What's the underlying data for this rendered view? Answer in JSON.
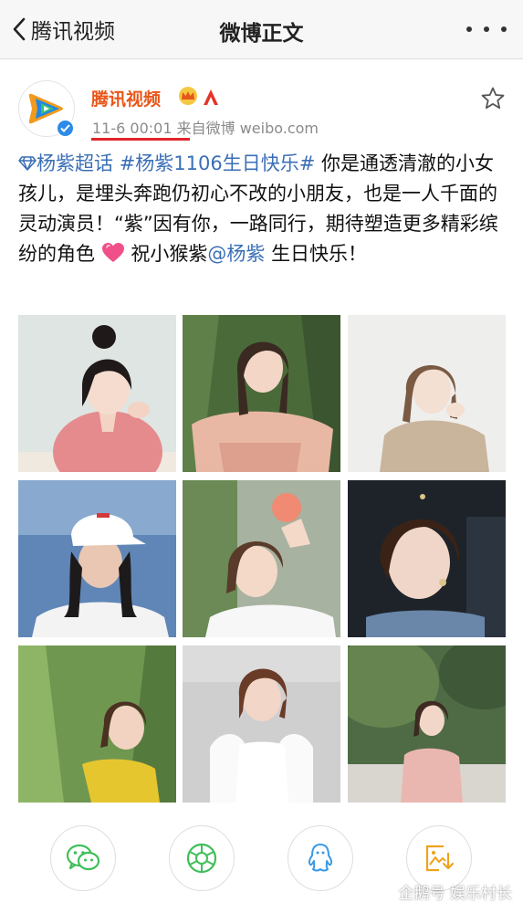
{
  "navbar": {
    "back_label": "腾讯视频",
    "title": "微博正文",
    "back_icon": "chevron-left-icon",
    "more_icon": "more-dots-icon"
  },
  "post": {
    "author": "腾讯视频",
    "timestamp": "11-6 00:01",
    "source": "来自微博 weibo.com",
    "body": {
      "topic1": "杨紫超话",
      "topic2": "#杨紫1106生日快乐#",
      "text1": "你是通透清澈的小女孩儿，是埋头奔跑仍初心不改的小朋友，也是一人千面的灵动演员！“紫”因有你，一路同行，期待塑造更多精彩缤纷的角色",
      "text2": "祝小猴紫",
      "mention": "@杨紫",
      "text3": "生日快乐！"
    },
    "accent_colors": {
      "author": "#e8561a",
      "link": "#3b6fb6",
      "underline": "#e0252b"
    }
  },
  "share": {
    "buttons": [
      "wechat-icon",
      "moments-icon",
      "qq-icon",
      "save-image-icon"
    ]
  },
  "watermark": {
    "text": "企鹅号 娱乐村长"
  }
}
